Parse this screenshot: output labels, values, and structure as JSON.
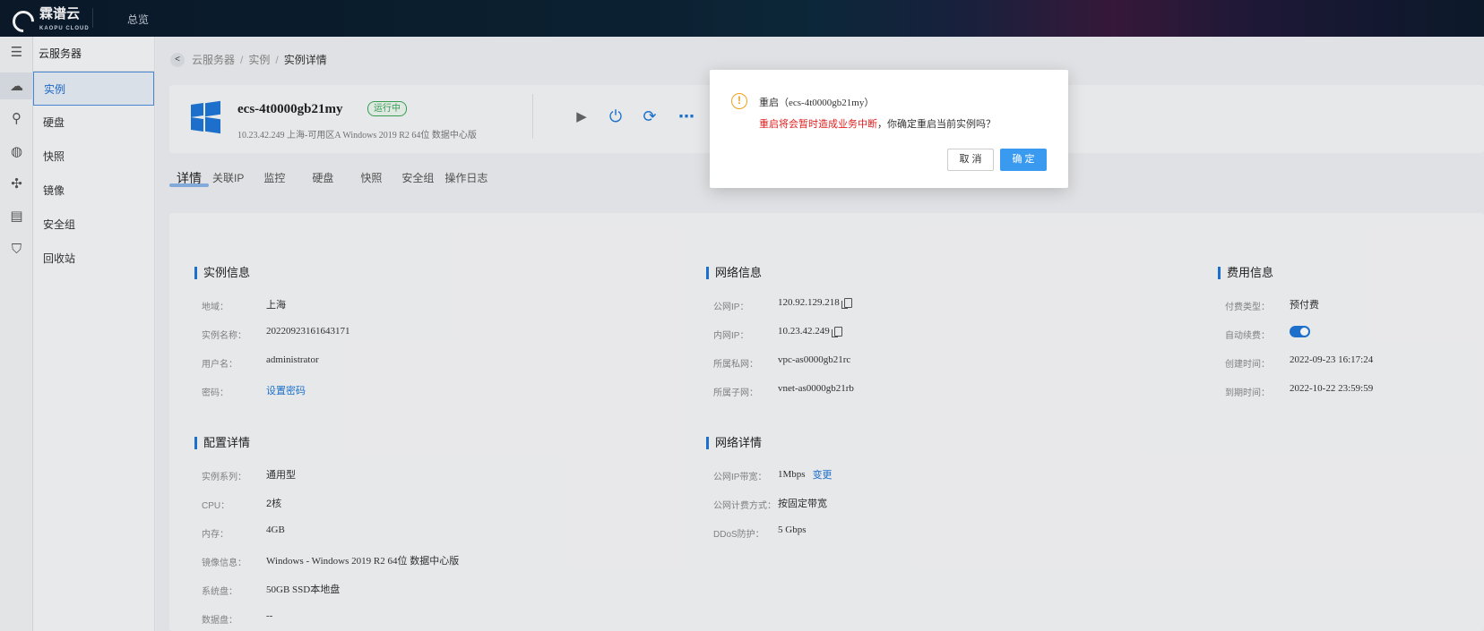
{
  "topbar": {
    "logo_text": "霖谱云",
    "logo_sub": "KAOPU CLOUD",
    "nav_overview": "总览"
  },
  "sidebar": {
    "title": "云服务器",
    "items": [
      {
        "label": "实例",
        "icon": "cloud-icon"
      },
      {
        "label": "硬盘",
        "icon": "disk-icon"
      },
      {
        "label": "快照",
        "icon": "globe-icon"
      },
      {
        "label": "镜像",
        "icon": "network-icon"
      },
      {
        "label": "安全组",
        "icon": "image-icon"
      },
      {
        "label": "回收站",
        "icon": "shield-icon"
      }
    ]
  },
  "breadcrumb": {
    "back": "<",
    "items": [
      "云服务器",
      "实例",
      "实例详情"
    ]
  },
  "instance": {
    "name": "ecs-4t0000gb21my",
    "status": "运行中",
    "subtitle": "10.23.42.249  上海-可用区A  Windows 2019 R2 64位 数据中心版",
    "actions": [
      "play-icon",
      "power-icon",
      "refresh-icon",
      "more-icon"
    ]
  },
  "tabs": [
    "详情",
    "关联IP",
    "监控",
    "硬盘",
    "快照",
    "安全组",
    "操作日志"
  ],
  "instance_info": {
    "title": "实例信息",
    "rows": [
      {
        "k": "地域：",
        "v": "上海"
      },
      {
        "k": "实例名称：",
        "v": "20220923161643171"
      },
      {
        "k": "用户名：",
        "v": "administrator"
      },
      {
        "k": "密码：",
        "v": "设置密码"
      }
    ]
  },
  "network_info": {
    "title": "网络信息",
    "rows": [
      {
        "k": "公网IP：",
        "v": "120.92.129.218"
      },
      {
        "k": "内网IP：",
        "v": "10.23.42.249"
      },
      {
        "k": "所属私网：",
        "v": "vpc-as0000gb21rc"
      },
      {
        "k": "所属子网：",
        "v": "vnet-as0000gb21rb"
      }
    ]
  },
  "fee_info": {
    "title": "费用信息",
    "rows": [
      {
        "k": "付费类型：",
        "v": "预付费"
      },
      {
        "k": "自动续费：",
        "v": ""
      },
      {
        "k": "创建时间：",
        "v": "2022-09-23 16:17:24"
      },
      {
        "k": "到期时间：",
        "v": "2022-10-22 23:59:59"
      }
    ]
  },
  "config_info": {
    "title": "配置详情",
    "rows": [
      {
        "k": "实例系列：",
        "v": "通用型"
      },
      {
        "k": "CPU：",
        "v": "2核"
      },
      {
        "k": "内存：",
        "v": "4GB"
      },
      {
        "k": "镜像信息：",
        "v": "Windows - Windows 2019 R2 64位 数据中心版"
      },
      {
        "k": "系统盘：",
        "v": "50GB SSD本地盘"
      },
      {
        "k": "数据盘：",
        "v": "--"
      }
    ]
  },
  "network_detail": {
    "title": "网络详情",
    "rows": [
      {
        "k": "公网IP带宽：",
        "v": "1Mbps",
        "link": "变更"
      },
      {
        "k": "公网计费方式：",
        "v": "按固定带宽"
      },
      {
        "k": "DDoS防护：",
        "v": "5 Gbps"
      }
    ]
  },
  "dialog": {
    "title_prefix": "重启（",
    "title_name": "ecs-4t0000gb21my",
    "title_suffix": "）",
    "warning": "重启将会暂时造成业务中断",
    "message": "，你确定重启当前实例吗？",
    "cancel": "取 消",
    "confirm": "确 定",
    "icon": "warning-icon"
  },
  "colors": {
    "accent": "#1e78d8",
    "success": "#3aa65a",
    "danger": "#e02020",
    "warning": "#f0a020"
  }
}
